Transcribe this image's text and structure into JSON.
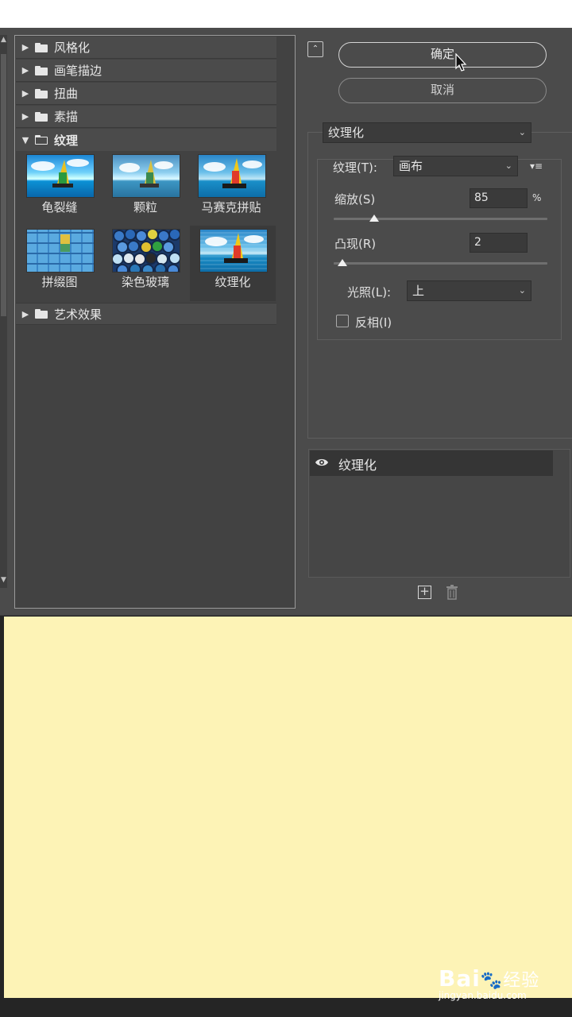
{
  "gallery": {
    "categories_top": [
      {
        "label": "风格化"
      },
      {
        "label": "画笔描边"
      },
      {
        "label": "扭曲"
      },
      {
        "label": "素描"
      }
    ],
    "open_category": {
      "label": "纹理"
    },
    "thumbnails": [
      {
        "label": "龟裂缝"
      },
      {
        "label": "颗粒"
      },
      {
        "label": "马赛克拼贴"
      },
      {
        "label": "拼缀图"
      },
      {
        "label": "染色玻璃"
      },
      {
        "label": "纹理化",
        "selected": true
      }
    ],
    "categories_bottom": [
      {
        "label": "艺术效果"
      }
    ]
  },
  "buttons": {
    "ok": "确定",
    "cancel": "取消"
  },
  "filter_select": {
    "value": "纹理化"
  },
  "params": {
    "texture_label": "纹理(T):",
    "texture_value": "画布",
    "scaling_label": "缩放(S)",
    "scaling_value": "85",
    "scaling_unit": "%",
    "scaling_fraction": 0.19,
    "relief_label": "凸现(R)",
    "relief_value": "2",
    "relief_fraction": 0.04,
    "light_label": "光照(L):",
    "light_value": "上",
    "invert_label": "反相(I)",
    "invert_checked": false
  },
  "layers": [
    {
      "name": "纹理化",
      "visible": true
    }
  ],
  "watermark": {
    "logo_text": "Bai",
    "logo_suffix": "经验",
    "url": "jingyan.baidu.com"
  },
  "colors": {
    "dialog_bg": "#4b4b4b",
    "canvas_bg": "#fdf3b6",
    "accent_text": "#e8e8e8"
  }
}
